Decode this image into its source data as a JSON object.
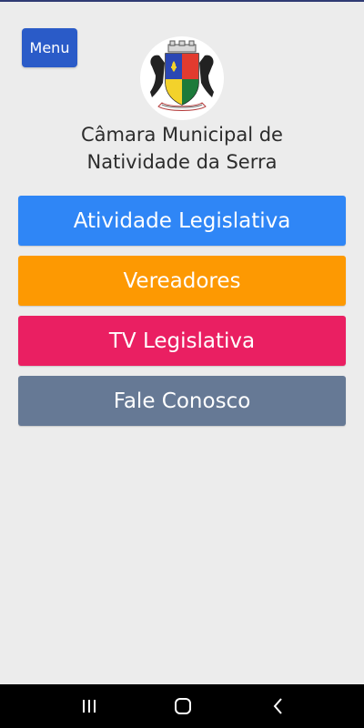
{
  "header": {
    "menu_label": "Menu",
    "title_line1": "Câmara Municipal de",
    "title_line2": "Natividade da Serra"
  },
  "logo": {
    "icon": "municipal-coat-of-arms"
  },
  "buttons": [
    {
      "label": "Atividade Legislativa",
      "color": "#2f86f6"
    },
    {
      "label": "Vereadores",
      "color": "#fd9902"
    },
    {
      "label": "TV Legislativa",
      "color": "#ea1f62"
    },
    {
      "label": "Fale Conosco",
      "color": "#667995"
    }
  ],
  "system_nav": {
    "recent_icon": "recent-apps-icon",
    "home_icon": "home-icon",
    "back_icon": "back-icon"
  },
  "colors": {
    "background": "#ececec",
    "menu_button": "#2a5bc8",
    "nav_bar": "#000000"
  }
}
